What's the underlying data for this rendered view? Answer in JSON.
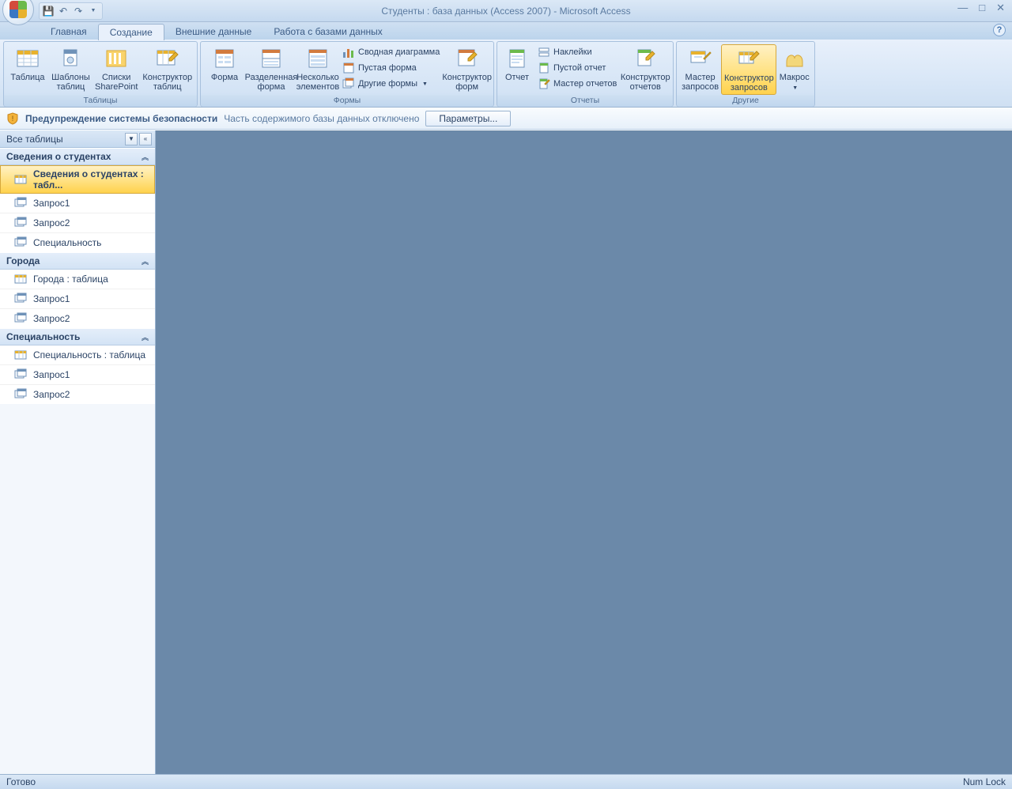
{
  "title": "Студенты : база данных (Access 2007) - Microsoft Access",
  "tabs": [
    "Главная",
    "Создание",
    "Внешние данные",
    "Работа с базами данных"
  ],
  "active_tab": 1,
  "ribbon": {
    "groups": [
      {
        "label": "Таблицы",
        "items": [
          {
            "name": "table",
            "label": "Таблица"
          },
          {
            "name": "table-templates",
            "label": "Шаблоны\nтаблиц",
            "dd": true
          },
          {
            "name": "sharepoint-lists",
            "label": "Списки\nSharePoint",
            "dd": true
          },
          {
            "name": "table-design",
            "label": "Конструктор\nтаблиц"
          }
        ]
      },
      {
        "label": "Формы",
        "big": [
          {
            "name": "form",
            "label": "Форма"
          },
          {
            "name": "split-form",
            "label": "Разделенная\nформа"
          },
          {
            "name": "multi-items",
            "label": "Несколько\nэлементов"
          }
        ],
        "small": [
          {
            "name": "pivot-chart",
            "label": "Сводная диаграмма"
          },
          {
            "name": "blank-form",
            "label": "Пустая форма"
          },
          {
            "name": "more-forms",
            "label": "Другие формы",
            "dd": true
          }
        ],
        "tail": {
          "name": "form-design",
          "label": "Конструктор\nформ"
        }
      },
      {
        "label": "Отчеты",
        "big": [
          {
            "name": "report",
            "label": "Отчет"
          }
        ],
        "small": [
          {
            "name": "labels",
            "label": "Наклейки"
          },
          {
            "name": "blank-report",
            "label": "Пустой отчет"
          },
          {
            "name": "report-wizard",
            "label": "Мастер отчетов"
          }
        ],
        "tail": {
          "name": "report-design",
          "label": "Конструктор\nотчетов"
        }
      },
      {
        "label": "Другие",
        "items": [
          {
            "name": "query-wizard",
            "label": "Мастер\nзапросов"
          },
          {
            "name": "query-design",
            "label": "Конструктор\nзапросов",
            "highlight": true
          },
          {
            "name": "macro",
            "label": "Макрос",
            "dd": true
          }
        ]
      }
    ]
  },
  "security": {
    "title": "Предупреждение системы безопасности",
    "text": "Часть содержимого базы данных отключено",
    "button": "Параметры..."
  },
  "nav": {
    "header": "Все таблицы",
    "categories": [
      {
        "label": "Сведения о студентах",
        "items": [
          {
            "type": "table",
            "label": "Сведения о студентах : табл...",
            "selected": true
          },
          {
            "type": "query",
            "label": "Запрос1"
          },
          {
            "type": "query",
            "label": "Запрос2"
          },
          {
            "type": "query",
            "label": "Специальность"
          }
        ]
      },
      {
        "label": "Города",
        "items": [
          {
            "type": "table",
            "label": "Города : таблица"
          },
          {
            "type": "query",
            "label": "Запрос1"
          },
          {
            "type": "query",
            "label": "Запрос2"
          }
        ]
      },
      {
        "label": "Специальность",
        "items": [
          {
            "type": "table",
            "label": "Специальность : таблица"
          },
          {
            "type": "query",
            "label": "Запрос1"
          },
          {
            "type": "query",
            "label": "Запрос2"
          }
        ]
      }
    ]
  },
  "status": {
    "left": "Готово",
    "right": "Num Lock"
  }
}
